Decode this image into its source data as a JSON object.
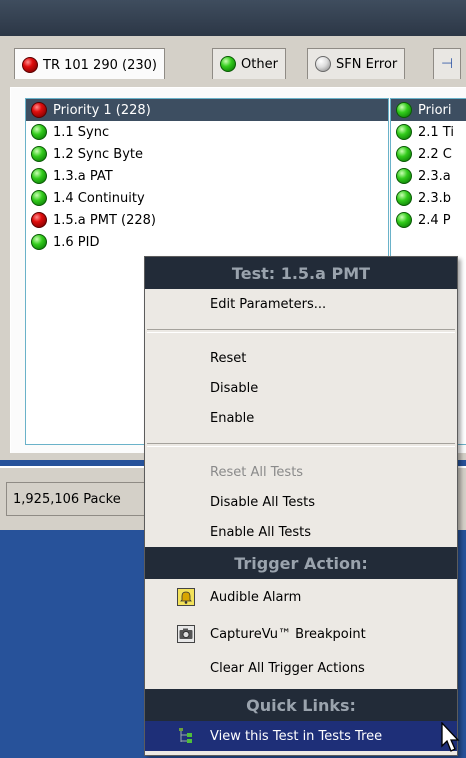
{
  "tabs": [
    {
      "label": "TR 101 290 (230)",
      "status": "red"
    },
    {
      "label": "Other",
      "status": "green"
    },
    {
      "label": "SFN Error",
      "status": "gray"
    }
  ],
  "priority1": {
    "header": "Priority 1 (228)",
    "items": [
      "1.1 Sync",
      "1.2 Sync Byte",
      "1.3.a PAT",
      "1.4 Continuity",
      "1.5.a PMT (228)",
      "1.6 PID"
    ]
  },
  "priority2": {
    "header": "Priori",
    "items": [
      "2.1 Ti",
      "2.2 C",
      "2.3.a",
      "2.3.b",
      "2.4 P"
    ]
  },
  "status_bar": {
    "packets": "1,925,106 Packe"
  },
  "menu": {
    "title": "Test: 1.5.a PMT",
    "edit": "Edit Parameters...",
    "reset": "Reset",
    "disable": "Disable",
    "enable": "Enable",
    "reset_all": "Reset All Tests",
    "disable_all": "Disable All Tests",
    "enable_all": "Enable All Tests",
    "trigger_header": "Trigger Action:",
    "audible": "Audible Alarm",
    "capturevu": "CaptureVu™ Breakpoint",
    "clear_triggers": "Clear All Trigger Actions",
    "quick_header": "Quick Links:",
    "view_tree": "View this Test in Tests Tree"
  },
  "colors": {
    "accent": "#1e2f78",
    "header_dark": "#222b38",
    "desktop_blue": "#27529a"
  }
}
